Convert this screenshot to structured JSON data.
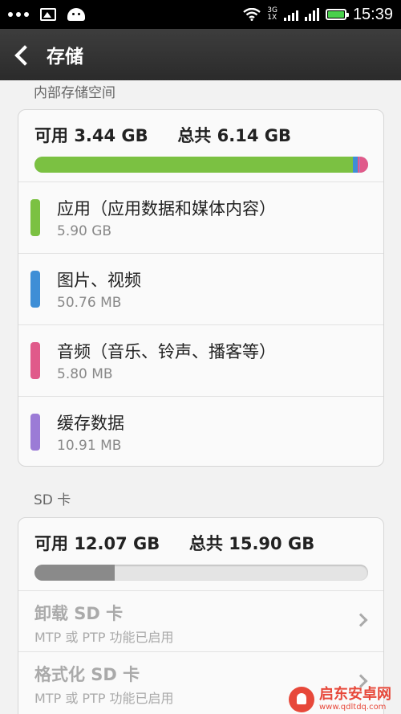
{
  "status_bar": {
    "time": "15:39",
    "network_top": "3G",
    "network_bottom": "1X"
  },
  "header": {
    "title": "存储"
  },
  "internal": {
    "section_title": "内部存储空间",
    "available_label": "可用",
    "available_value": "3.44 GB",
    "total_label": "总共",
    "total_value": "6.14 GB",
    "categories": [
      {
        "name": "应用（应用数据和媒体内容）",
        "size": "5.90 GB",
        "color": "#7bc142"
      },
      {
        "name": "图片、视频",
        "size": "50.76 MB",
        "color": "#3e8ed6"
      },
      {
        "name": "音频（音乐、铃声、播客等）",
        "size": "5.80 MB",
        "color": "#e05a8a"
      },
      {
        "name": "缓存数据",
        "size": "10.91 MB",
        "color": "#9b7bd6"
      }
    ]
  },
  "sd_card": {
    "section_title": "SD 卡",
    "available_label": "可用",
    "available_value": "12.07 GB",
    "total_label": "总共",
    "total_value": "15.90 GB",
    "used_fraction": 0.24,
    "bar_color": "#8a8a8a",
    "actions": [
      {
        "title": "卸载 SD 卡",
        "subtitle": "MTP 或 PTP 功能已启用"
      },
      {
        "title": "格式化 SD 卡",
        "subtitle": "MTP 或 PTP 功能已启用"
      }
    ]
  },
  "watermark": {
    "name": "启东安卓网",
    "url": "www.qdltdq.com"
  }
}
